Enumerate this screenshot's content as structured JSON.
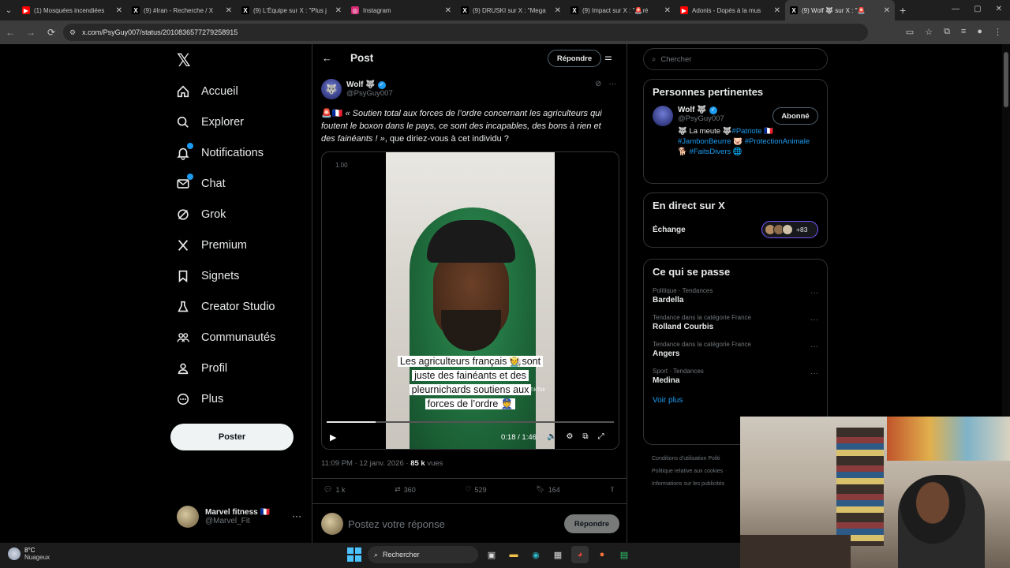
{
  "browser": {
    "tabs": [
      {
        "label": "(1) Mosquées incendiées",
        "icon": "youtube-icon",
        "color": "#ff0000",
        "active": false
      },
      {
        "label": "(9) #Iran - Recherche / X",
        "icon": "x-icon",
        "color": "#000000",
        "active": false
      },
      {
        "label": "(9) L'Équipe sur X : \"Plus j",
        "icon": "x-icon",
        "color": "#000000",
        "active": false
      },
      {
        "label": "Instagram",
        "icon": "instagram-icon",
        "color": "#d62976",
        "active": false
      },
      {
        "label": "(9) DRUSKI sur X : \"Mega",
        "icon": "x-icon",
        "color": "#000000",
        "active": false
      },
      {
        "label": "(9) Impact sur X : \"🚨ré",
        "icon": "x-icon",
        "color": "#000000",
        "active": false
      },
      {
        "label": "Adonis - Dopés à la mus",
        "icon": "youtube-icon",
        "color": "#ff0000",
        "active": false
      },
      {
        "label": "(9) Wolf 🐺 sur X : \"🚨 ",
        "icon": "x-icon",
        "color": "#000000",
        "active": true
      }
    ],
    "url": "x.com/PsyGuy007/status/2010836577279258915"
  },
  "nav": {
    "items": [
      {
        "label": "Accueil",
        "icon": "home-icon",
        "badge": false
      },
      {
        "label": "Explorer",
        "icon": "search-icon",
        "badge": false
      },
      {
        "label": "Notifications",
        "icon": "bell-icon",
        "badge": true
      },
      {
        "label": "Chat",
        "icon": "mail-icon",
        "badge": true
      },
      {
        "label": "Grok",
        "icon": "grok-icon",
        "badge": false
      },
      {
        "label": "Premium",
        "icon": "x-logo-icon",
        "badge": false
      },
      {
        "label": "Signets",
        "icon": "bookmark-icon",
        "badge": false
      },
      {
        "label": "Creator Studio",
        "icon": "flask-icon",
        "badge": false
      },
      {
        "label": "Communautés",
        "icon": "people-icon",
        "badge": false
      },
      {
        "label": "Profil",
        "icon": "user-icon",
        "badge": false
      },
      {
        "label": "Plus",
        "icon": "more-circle-icon",
        "badge": false
      }
    ],
    "post_button": "Poster",
    "account": {
      "name": "Marvel fitness 🇫🇷",
      "handle": "@Marvel_Fit"
    }
  },
  "post": {
    "header_title": "Post",
    "reply_pill": "Répondre",
    "author": {
      "name": "Wolf 🐺",
      "handle": "@PsyGuy007"
    },
    "text_prefix": "🚨🇫🇷 ",
    "text_quote": "« Soutien total aux forces de l’ordre concernant les agriculteurs qui foutent le boxon dans le pays, ce sont des incapables, des bons à rien et des fainéants ! »",
    "text_suffix": ", que diriez-vous à cet individu ?",
    "video": {
      "speed": "1.00",
      "caption": "Les agriculteurs français 🧑‍🌾sont juste des fainéants et des pleurnichards soutiens aux forces de l’ordre 👮",
      "watermark": "TikTok",
      "time": "0:18 / 1:46",
      "progress": 0.17
    },
    "timestamp": "11:09 PM · 12 janv. 2026 · ",
    "views_count": "85 k",
    "views_label": " vues",
    "stats": {
      "replies": "1 k",
      "reposts": "360",
      "likes": "529",
      "bookmarks": "164"
    },
    "reply_placeholder": "Postez votre réponse",
    "reply_button": "Répondre"
  },
  "sidebar": {
    "search_placeholder": "Chercher",
    "relevant": {
      "title": "Personnes pertinentes",
      "name": "Wolf 🐺",
      "handle": "@PsyGuy007",
      "follow_label": "Abonné",
      "bio_plain": "🐺 La meute 🐺",
      "bio_tag1": "#Patriote",
      "bio_flag": " 🇫🇷 ",
      "bio_tag2": "#JambonBeurre",
      "bio_pig": " 🐷 ",
      "bio_tag3": "#ProtectionAnimale",
      "bio_dog": " 🐕 ",
      "bio_tag4": "#FaitsDivers",
      "bio_globe": " 🌐"
    },
    "live": {
      "title": "En direct sur X",
      "label": "Échange",
      "count": "+83"
    },
    "trends": {
      "title": "Ce qui se passe",
      "items": [
        {
          "category": "Politique · Tendances",
          "name": "Bardella"
        },
        {
          "category": "Tendance dans la catégorie France",
          "name": "Rolland Courbis"
        },
        {
          "category": "Tendance dans la catégorie France",
          "name": "Angers"
        },
        {
          "category": "Sport · Tendances",
          "name": "Medina"
        }
      ],
      "more": "Voir plus"
    },
    "footer": [
      "Conditions d'utilisation   Politi",
      "Politique relative aux cookies",
      "Informations sur les publicités"
    ]
  },
  "taskbar": {
    "temperature": "8°C",
    "weather": "Nuageux",
    "search_label": "Rechercher"
  }
}
